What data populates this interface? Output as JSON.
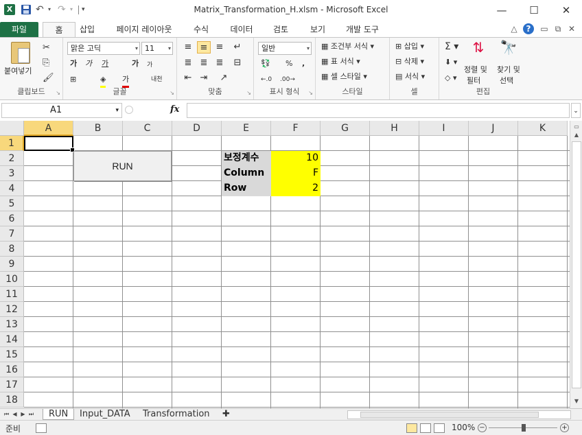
{
  "window": {
    "title": "Matrix_Transformation_H.xlsm  -  Microsoft Excel",
    "minimize": "—",
    "maximize": "☐",
    "close": "✕"
  },
  "qat": {
    "app_icon": "X",
    "undo": "↶",
    "redo": "↷",
    "drop": "▾"
  },
  "ribbon_tabs": [
    "파일",
    "홈",
    "삽입",
    "페이지 레이아웃",
    "수식",
    "데이터",
    "검토",
    "보기",
    "개발 도구"
  ],
  "ribbon_right": {
    "caret": "△",
    "help": "?",
    "min": "▭",
    "restore": "⧉",
    "close": "✕"
  },
  "ribbon": {
    "clipboard": {
      "paste": "붙여넣기",
      "label": "클립보드"
    },
    "font": {
      "name": "맑은 고딕",
      "size": "11",
      "label": "글꼴",
      "bold": "가",
      "italic": "가",
      "underline": "가",
      "grow": "가",
      "shrink": "가",
      "phonetic": "내천"
    },
    "align": {
      "label": "맞춤"
    },
    "number": {
      "format": "일반",
      "label": "표시 형식",
      "pct": "%",
      "comma": ","
    },
    "styles": {
      "cond": "조건부 서식",
      "table": "표 서식",
      "cell": "셀 스타일",
      "label": "스타일"
    },
    "cells": {
      "insert": "삽입",
      "delete": "삭제",
      "format": "서식",
      "label": "셀"
    },
    "editing": {
      "sum": "Σ",
      "sort": "정렬 및",
      "sort2": "필터",
      "find": "찾기 및",
      "find2": "선택",
      "label": "편집"
    }
  },
  "formula_bar": {
    "name_box": "A1",
    "fx": "fx",
    "value": ""
  },
  "columns": [
    "A",
    "B",
    "C",
    "D",
    "E",
    "F",
    "G",
    "H",
    "I",
    "J",
    "K"
  ],
  "rows": [
    "1",
    "2",
    "3",
    "4",
    "5",
    "6",
    "7",
    "8",
    "9",
    "10",
    "11",
    "12",
    "13",
    "14",
    "15",
    "16",
    "17",
    "18"
  ],
  "cells": {
    "E2": "보정계수",
    "F2": "10",
    "E3": "Column",
    "F3": "F",
    "E4": "Row",
    "F4": "2"
  },
  "run_button": {
    "label": "RUN"
  },
  "sheets": [
    "RUN",
    "Input_DATA",
    "Transformation"
  ],
  "status": {
    "ready": "준비",
    "zoom": "100%",
    "minus": "−",
    "plus": "+"
  },
  "colors": {
    "excel_green": "#1e7145",
    "yellow": "#ffff00",
    "label_gray": "#d9d9d9",
    "selected_header": "#f8d87c"
  }
}
